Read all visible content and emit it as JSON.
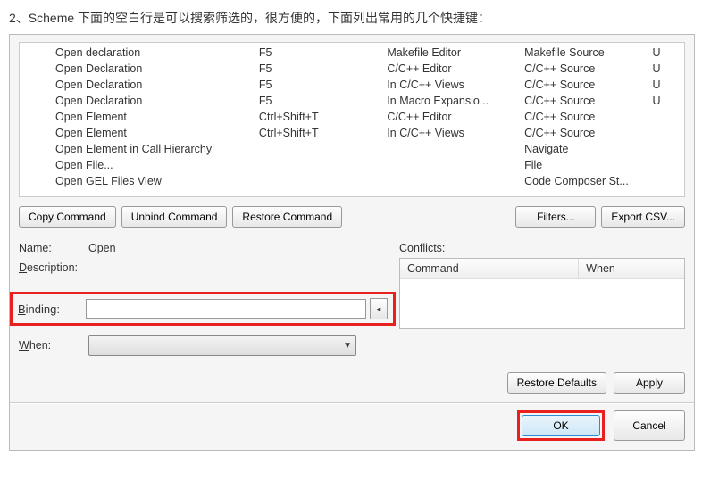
{
  "intro": "2、Scheme 下面的空白行是可以搜索筛选的，很方便的，下面列出常用的几个快捷键：",
  "keyTable": {
    "rows": [
      {
        "cmd": "Open declaration",
        "bind": "F5",
        "when": "Makefile Editor",
        "cat": "Makefile Source",
        "user": "U"
      },
      {
        "cmd": "Open Declaration",
        "bind": "F5",
        "when": "C/C++ Editor",
        "cat": "C/C++ Source",
        "user": "U"
      },
      {
        "cmd": "Open Declaration",
        "bind": "F5",
        "when": "In C/C++ Views",
        "cat": "C/C++ Source",
        "user": "U"
      },
      {
        "cmd": "Open Declaration",
        "bind": "F5",
        "when": "In Macro Expansio...",
        "cat": "C/C++ Source",
        "user": "U"
      },
      {
        "cmd": "Open Element",
        "bind": "Ctrl+Shift+T",
        "when": "C/C++ Editor",
        "cat": "C/C++ Source",
        "user": ""
      },
      {
        "cmd": "Open Element",
        "bind": "Ctrl+Shift+T",
        "when": "In C/C++ Views",
        "cat": "C/C++ Source",
        "user": ""
      },
      {
        "cmd": "Open Element in Call Hierarchy",
        "bind": "",
        "when": "",
        "cat": "Navigate",
        "user": ""
      },
      {
        "cmd": "Open File...",
        "bind": "",
        "when": "",
        "cat": "File",
        "user": ""
      },
      {
        "cmd": "Open GEL Files View",
        "bind": "",
        "when": "",
        "cat": "Code Composer St...",
        "user": ""
      }
    ]
  },
  "buttons": {
    "copy": "Copy Command",
    "unbind": "Unbind Command",
    "restore": "Restore Command",
    "filters": "Filters...",
    "export": "Export CSV..."
  },
  "form": {
    "nameLabel": "Name:",
    "nameValue": "Open",
    "descLabel": "Description:",
    "bindingLabel": "Binding:",
    "whenLabel": "When:",
    "conflictsLabel": "Conflicts:",
    "conflictsCmd": "Command",
    "conflictsWhen": "When"
  },
  "footer": {
    "restoreDefaults": "Restore Defaults",
    "apply": "Apply",
    "ok": "OK",
    "cancel": "Cancel"
  }
}
